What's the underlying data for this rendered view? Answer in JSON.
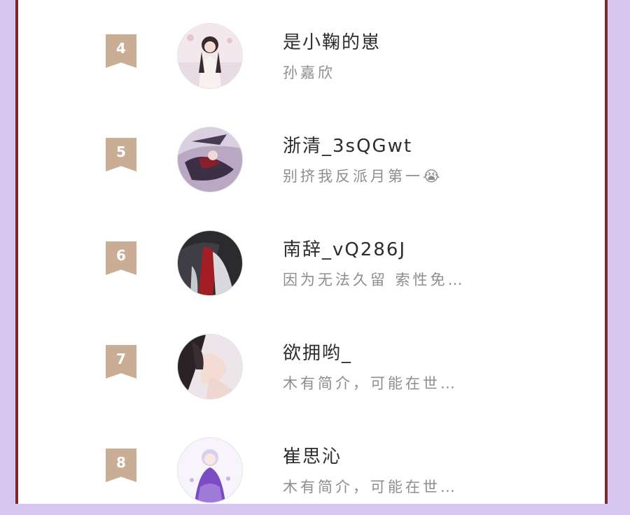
{
  "entries": [
    {
      "rank": "4",
      "name": "是小鞠的崽",
      "bio": "孙嘉欣"
    },
    {
      "rank": "5",
      "name": "浙清_3sQGwt",
      "bio": "别挤我反派月第一😭"
    },
    {
      "rank": "6",
      "name": "南辞_vQ286J",
      "bio": "因为无法久留 索性免…"
    },
    {
      "rank": "7",
      "name": "欲拥哟_",
      "bio": "木有简介，可能在世…"
    },
    {
      "rank": "8",
      "name": "崔思沁",
      "bio": "木有简介，可能在世…"
    }
  ],
  "colors": {
    "background": "#d9c6f0",
    "frame": "#7a2a2e",
    "rank_badge": "#c9ad94",
    "name_text": "#2d2d2d",
    "bio_text": "#8e8e8e"
  }
}
